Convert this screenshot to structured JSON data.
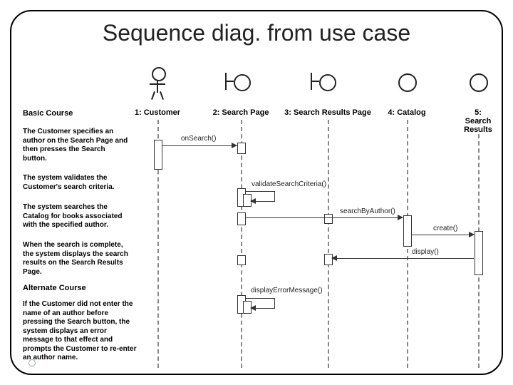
{
  "title": "Sequence diag. from use case",
  "lifelines": {
    "l1": "1: Customer",
    "l2": "2: Search Page",
    "l3": "3: Search Results Page",
    "l4": "4: Catalog",
    "l5": "5: Search Results"
  },
  "sidebar": {
    "basic_heading": "Basic Course",
    "p1": "The Customer specifies an author on the Search Page and then presses the Search button.",
    "p2": "The system validates the Customer's search criteria.",
    "p3": "The system searches the Catalog for books associated with the specified author.",
    "p4": "When the search is complete, the system displays the search results on the  Search Results Page.",
    "alt_heading": "Alternate Course",
    "p5": "If the Customer did not enter the name of an author before pressing the Search button, the system displays an error message to that effect and prompts the Customer to re-enter an author name."
  },
  "messages": {
    "m1": "onSearch()",
    "m2": "validateSearchCriteria()",
    "m3": "searchByAuthor()",
    "m4": "create()",
    "m5": "display()",
    "m6": "displayErrorMessage()"
  }
}
